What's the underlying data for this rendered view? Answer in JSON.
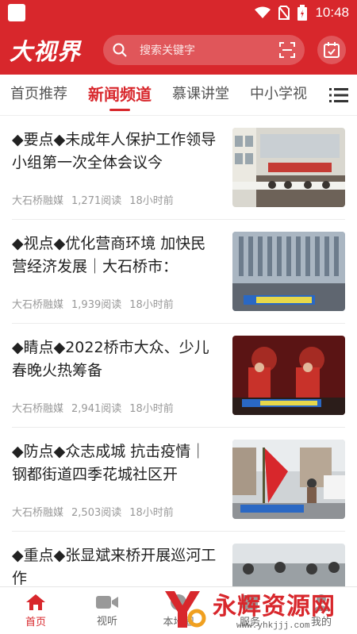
{
  "status_bar": {
    "time": "10:48"
  },
  "header": {
    "logo": "大视界",
    "search_placeholder": "搜索关键字"
  },
  "tabs": [
    {
      "label": "首页推荐"
    },
    {
      "label": "新闻频道"
    },
    {
      "label": "慕课讲堂"
    },
    {
      "label": "中小学视"
    }
  ],
  "articles": [
    {
      "title": "◆要点◆未成年人保护工作领导小组第一次全体会议今",
      "source": "大石桥融媒",
      "reads": "1,271阅读",
      "time": "18小时前"
    },
    {
      "title": "◆视点◆优化营商环境 加快民营经济发展｜大石桥市：",
      "source": "大石桥融媒",
      "reads": "1,939阅读",
      "time": "18小时前"
    },
    {
      "title": "◆睛点◆2022桥市大众、少儿春晚火热筹备",
      "source": "大石桥融媒",
      "reads": "2,941阅读",
      "time": "18小时前"
    },
    {
      "title": "◆防点◆众志成城 抗击疫情｜钢都街道四季花城社区开",
      "source": "大石桥融媒",
      "reads": "2,503阅读",
      "time": "18小时前"
    },
    {
      "title": "◆重点◆张显斌来桥开展巡河工作",
      "source": "",
      "reads": "",
      "time": ""
    }
  ],
  "bottom_nav": [
    {
      "label": "首页"
    },
    {
      "label": "视听"
    },
    {
      "label": "本地圈"
    },
    {
      "label": "服务"
    },
    {
      "label": "我的"
    }
  ],
  "watermark": {
    "main": "永辉资源网",
    "url": "www.yhkjjj.com"
  },
  "colors": {
    "brand": "#d8272c"
  }
}
